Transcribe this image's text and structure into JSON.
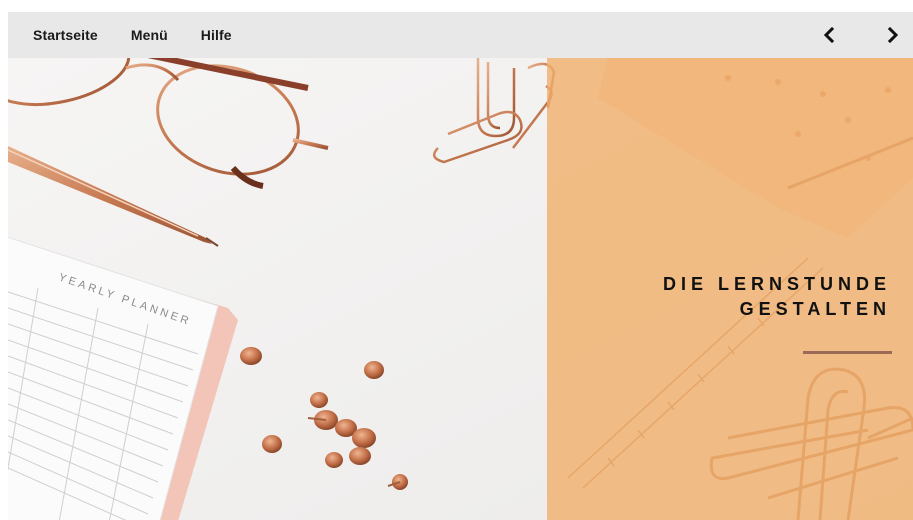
{
  "nav": {
    "items": [
      {
        "label": "Startseite"
      },
      {
        "label": "Menü"
      },
      {
        "label": "Hilfe"
      }
    ]
  },
  "slider": {
    "prev_icon": "chevron-left-icon",
    "next_icon": "chevron-right-icon"
  },
  "hero": {
    "headline_line1": "DIE LERNSTUNDE",
    "headline_line2": "GESTALTEN",
    "planner_title": "YEARLY PLANNER",
    "accent_color": "#f0b06c",
    "line_color": "#9a6a56"
  }
}
